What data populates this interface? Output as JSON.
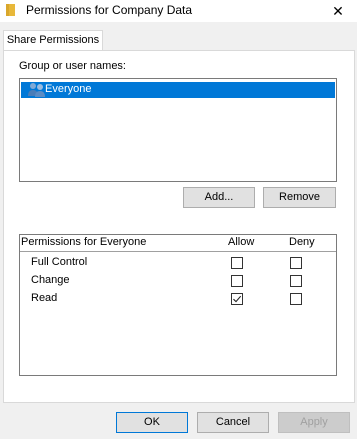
{
  "window": {
    "title": "Permissions for Company Data",
    "icon": "folder-icon",
    "close_glyph": "✕"
  },
  "tabs": [
    {
      "label": "Share Permissions"
    }
  ],
  "group_section": {
    "label": "Group or user names:",
    "items": [
      {
        "label": "Everyone",
        "icon": "users-icon",
        "selected": true
      }
    ],
    "add_label": "Add...",
    "remove_label": "Remove"
  },
  "permissions": {
    "header_label": "Permissions for Everyone",
    "allow_label": "Allow",
    "deny_label": "Deny",
    "rows": [
      {
        "name": "Full Control",
        "allow": false,
        "deny": false
      },
      {
        "name": "Change",
        "allow": false,
        "deny": false
      },
      {
        "name": "Read",
        "allow": true,
        "deny": false
      }
    ]
  },
  "footer": {
    "ok_label": "OK",
    "cancel_label": "Cancel",
    "apply_label": "Apply",
    "apply_enabled": false
  },
  "colors": {
    "selection": "#0078d7",
    "folder": "#e8b83a"
  }
}
